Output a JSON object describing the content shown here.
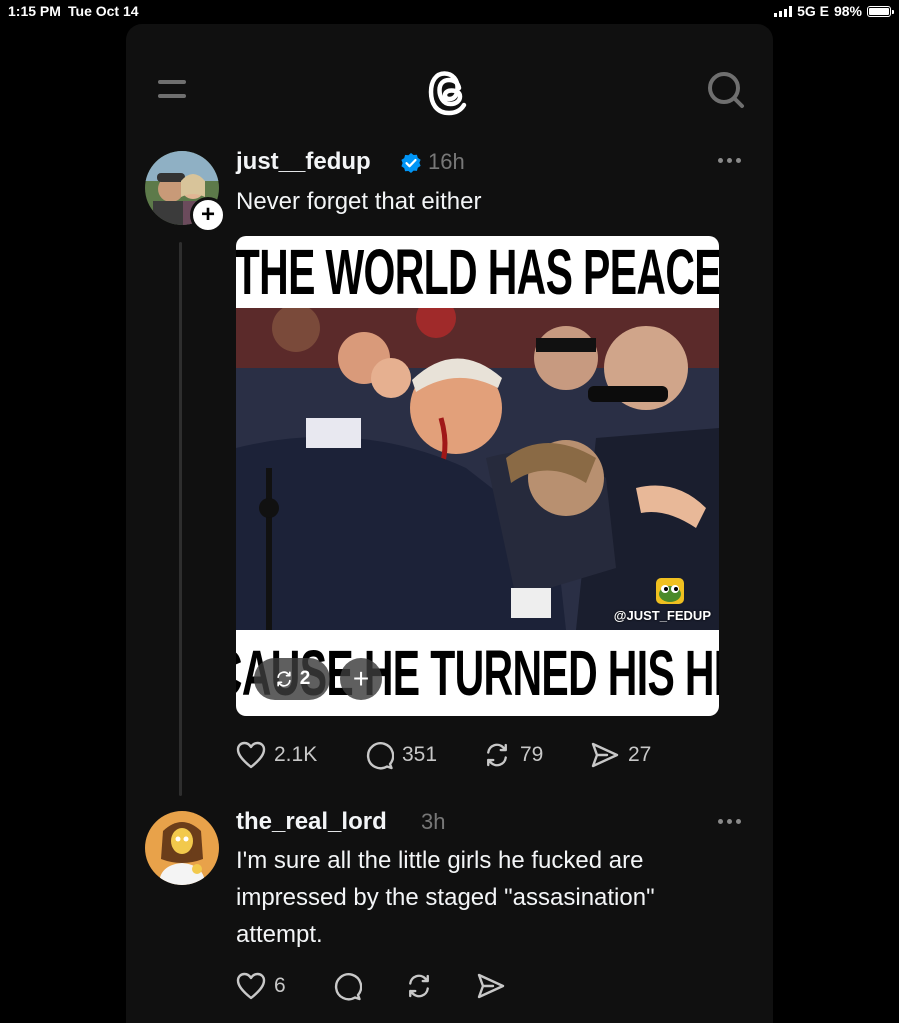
{
  "status_bar": {
    "time": "1:15 PM",
    "date": "Tue Oct 14",
    "network": "5G E",
    "battery": "98%",
    "battery_level": 0.98
  },
  "header": {
    "menu_icon": "menu-icon",
    "logo_icon": "threads-logo-icon",
    "search_icon": "search-icon"
  },
  "posts": [
    {
      "username": "just__fedup",
      "verified": true,
      "time": "16h",
      "text": "Never forget that either",
      "image": {
        "top_caption": "THE WORLD HAS PEACE",
        "bottom_caption": "BECAUSE HE TURNED HIS HEAD",
        "watermark": "@JUST_FEDUP",
        "repost_count": "2"
      },
      "likes": "2.1K",
      "replies": "351",
      "reposts": "79",
      "shares": "27"
    },
    {
      "username": "the_real_lord",
      "time": "3h",
      "text_lines": [
        "I'm sure all the little girls he fucked are",
        "impressed by the staged \"assasination\"",
        "attempt."
      ],
      "likes": "6"
    }
  ],
  "colors": {
    "background": "#000000",
    "panel": "#101010",
    "verified": "#0095f6",
    "secondary_text": "#777777"
  }
}
